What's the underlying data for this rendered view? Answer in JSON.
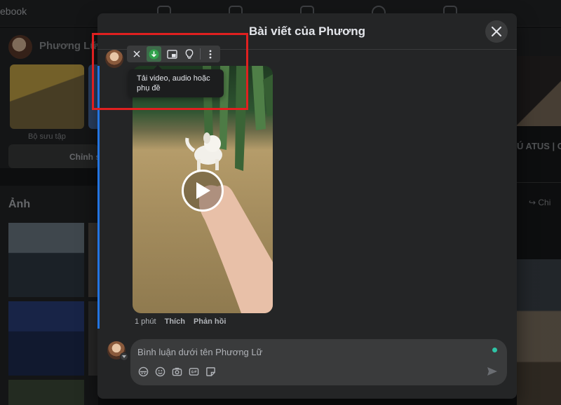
{
  "background": {
    "brand_text": "ebook",
    "profile_name": "Phương Lữ",
    "collection_label": "Bộ sưu tập",
    "edit_button_label": "Chỉnh s",
    "photos_title": "Ảnh",
    "right_text": "Ú ATUS | C",
    "right_share": "Chi"
  },
  "modal": {
    "title": "Bài viết của Phương",
    "close_icon": "close-icon"
  },
  "toolbar": {
    "tooltip": "Tải video, audio hoặc phụ đề",
    "buttons": [
      "close-icon",
      "download-icon",
      "picture-in-picture-icon",
      "lightbulb-icon",
      "more-icon"
    ],
    "active_color": "#3e6b4a",
    "download_color": "#31a24c"
  },
  "comment": {
    "time": "1 phút",
    "like_label": "Thích",
    "reply_label": "Phản hồi"
  },
  "composer": {
    "placeholder": "Bình luận dưới tên Phương Lữ",
    "icons": [
      "avatar-sticker-icon",
      "emoji-icon",
      "camera-icon",
      "gif-icon",
      "sticker-icon"
    ],
    "send_icon": "send-icon",
    "online_color": "#2ec4a6"
  },
  "colors": {
    "highlight": "#e02020",
    "accent_blue": "#2374e1"
  }
}
